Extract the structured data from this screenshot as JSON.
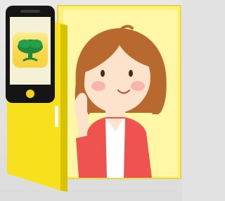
{
  "scene": {
    "colors": {
      "background": "#e2e2e2",
      "window_frame": "#fff07a",
      "window_inner": "#fff7a8",
      "door_yellow": "#f7e11c",
      "door_shade": "#d9c200",
      "hair": "#b86a2e",
      "skin": "#fde3cc",
      "blush": "#f5a4a6",
      "jacket": "#ef5350",
      "shirt": "#ffffff",
      "phone_body": "#151515",
      "phone_screen": "#f5f1d6",
      "app_bg": "#f8d84a",
      "tree": "#1f8a3d",
      "home_button": "#f6d21a"
    },
    "icons": {
      "phone": "smartphone-icon",
      "app": "tree-app-icon"
    }
  }
}
